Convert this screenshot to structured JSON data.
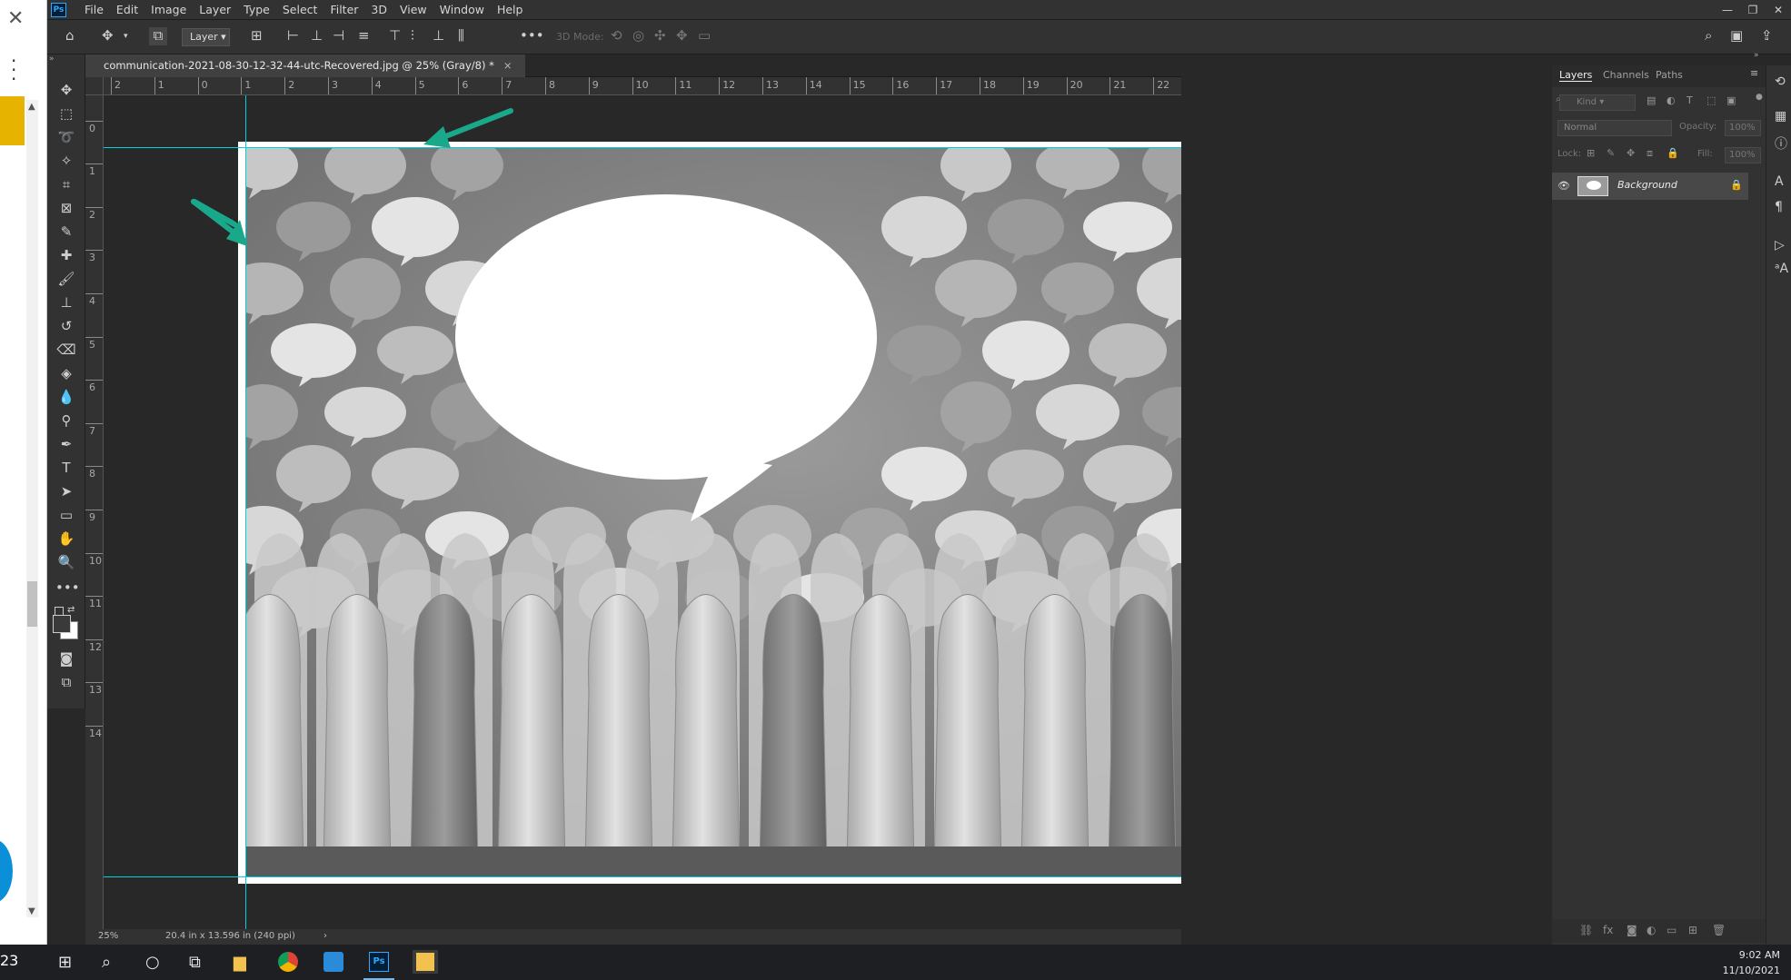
{
  "browser_sliver": {
    "close_icon": "close-icon",
    "menu_icon": "kebab-menu-icon",
    "taskbar_badge": "23"
  },
  "menubar": {
    "app_logo": "Ps",
    "items": [
      "File",
      "Edit",
      "Image",
      "Layer",
      "Type",
      "Select",
      "Filter",
      "3D",
      "View",
      "Window",
      "Help"
    ]
  },
  "options_bar": {
    "auto_select_target": "Layer",
    "mode_3d_label": "3D Mode:"
  },
  "document": {
    "tab_title": "communication-2021-08-30-12-32-44-utc-Recovered.jpg @ 25% (Gray/8) *",
    "zoom": "25%",
    "doc_info": "20.4 in x 13.596 in (240 ppi)"
  },
  "rulers": {
    "top_labels": [
      "2",
      "1",
      "0",
      "1",
      "2",
      "3",
      "4",
      "5",
      "6",
      "7",
      "8",
      "9",
      "10",
      "11",
      "12",
      "13",
      "14",
      "15",
      "16",
      "17",
      "18",
      "19",
      "20",
      "21",
      "22"
    ],
    "left_labels": [
      "1",
      "0",
      "1",
      "2",
      "3",
      "4",
      "5",
      "6",
      "7",
      "8",
      "9",
      "10",
      "11",
      "12",
      "13",
      "14"
    ]
  },
  "layers_panel": {
    "tabs": [
      "Layers",
      "Channels",
      "Paths"
    ],
    "active_tab": "Layers",
    "filter_placeholder": "Kind",
    "blend_mode": "Normal",
    "opacity_label": "Opacity:",
    "opacity_value": "100%",
    "lock_label": "Lock:",
    "fill_label": "Fill:",
    "fill_value": "100%",
    "layers": [
      {
        "name": "Background",
        "visible": true,
        "locked": true
      }
    ]
  },
  "taskbar": {
    "time": "9:02 AM",
    "date": "11/10/2021"
  },
  "colors": {
    "guide": "#00d0e0",
    "arrow": "#1aa88a",
    "ps_bg": "#282828"
  }
}
